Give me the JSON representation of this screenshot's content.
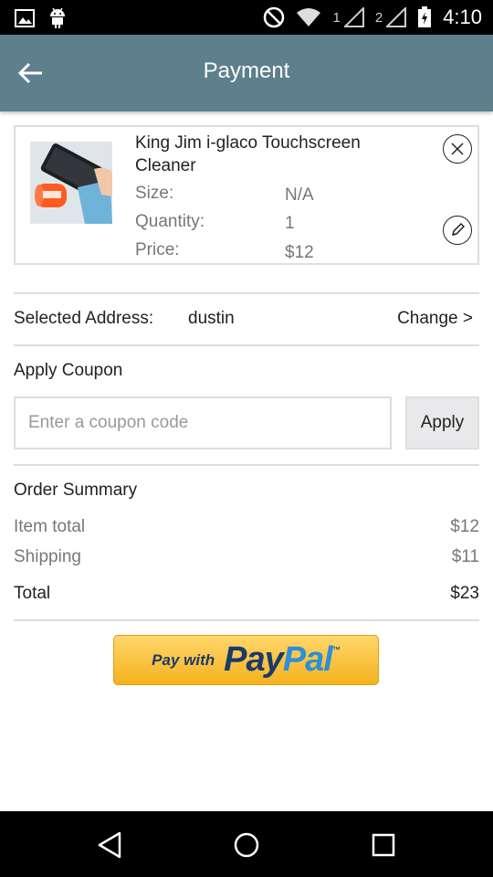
{
  "status_bar": {
    "time": "4:10",
    "sim1_label": "1",
    "sim2_label": "2",
    "icons": [
      "image-icon",
      "android-icon",
      "do-not-disturb-icon",
      "wifi-icon",
      "signal-icon",
      "battery-charging-icon"
    ]
  },
  "app_bar": {
    "title": "Payment",
    "back_icon": "arrow-left-icon"
  },
  "product": {
    "name": "King Jim i-glaco Touchscreen Cleaner",
    "size_label": "Size:",
    "size_value": "N/A",
    "quantity_label": "Quantity:",
    "quantity_value": "1",
    "price_label": "Price:",
    "price_value": "$12",
    "remove_icon": "close-circle-icon",
    "edit_icon": "pencil-circle-icon"
  },
  "address": {
    "label": "Selected Address:",
    "value": "dustin",
    "change_label": "Change >"
  },
  "coupon": {
    "heading": "Apply Coupon",
    "placeholder": "Enter a coupon code",
    "value": "",
    "apply_label": "Apply"
  },
  "summary": {
    "heading": "Order Summary",
    "item_total_label": "Item total",
    "item_total_value": "$12",
    "shipping_label": "Shipping",
    "shipping_value": "$11",
    "total_label": "Total",
    "total_value": "$23"
  },
  "paypal": {
    "with_text": "Pay with",
    "logo_pay": "Pay",
    "logo_pal": "Pal",
    "tm": "™"
  },
  "nav_bar": {
    "icons": [
      "back-triangle-icon",
      "home-circle-icon",
      "recents-square-icon"
    ]
  },
  "colors": {
    "app_bar": "#5e7f8c",
    "paypal_yellow": "#f5b21f",
    "paypal_navy": "#1b3a6b",
    "paypal_blue": "#2c8fd8"
  }
}
